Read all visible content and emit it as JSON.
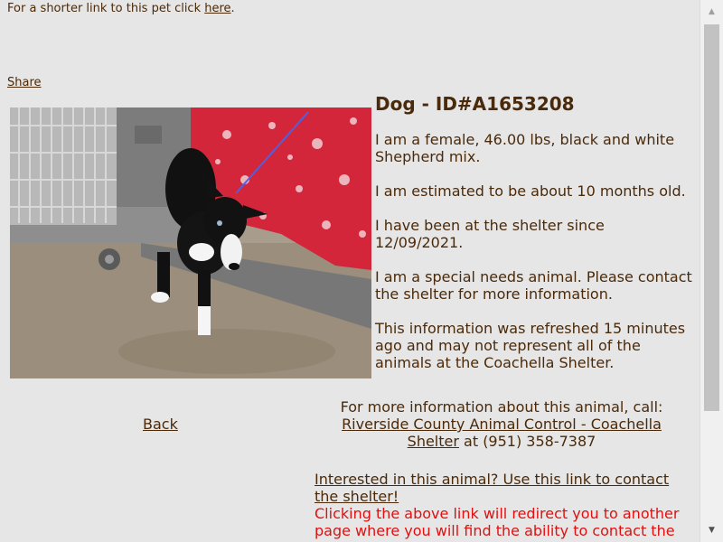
{
  "top": {
    "short_link_text": "For a shorter link to this pet click ",
    "short_link_anchor": "here",
    "short_link_suffix": "."
  },
  "share_label": "Share",
  "photo": {
    "description_icon": "dog-photo"
  },
  "animal": {
    "title": "Dog - ID#A1653208",
    "desc1": "I am a female, 46.00 lbs, black and white Shepherd mix.",
    "desc2": "I am estimated to be about 10 months old.",
    "desc3": "I have been at the shelter since 12/09/2021.",
    "desc4": "I am a special needs animal. Please contact the shelter for more information.",
    "desc5": "This information was refreshed 15 minutes ago and may not represent all of the animals at the Coachella Shelter."
  },
  "back_label": "Back",
  "contact": {
    "intro": "For more information about this animal, call:",
    "shelter_link": "Riverside County Animal Control - Coachella Shelter",
    "phone_suffix": " at (951) 358-7387"
  },
  "interest": {
    "link_text": "Interested in this animal? Use this link to contact the shelter!",
    "redirect_note": "Clicking the above link will redirect you to another page where you will find the ability to contact the shelter."
  },
  "colors": {
    "background": "#e6e6e6",
    "text": "#4a2a0a",
    "warning": "#e01010"
  }
}
